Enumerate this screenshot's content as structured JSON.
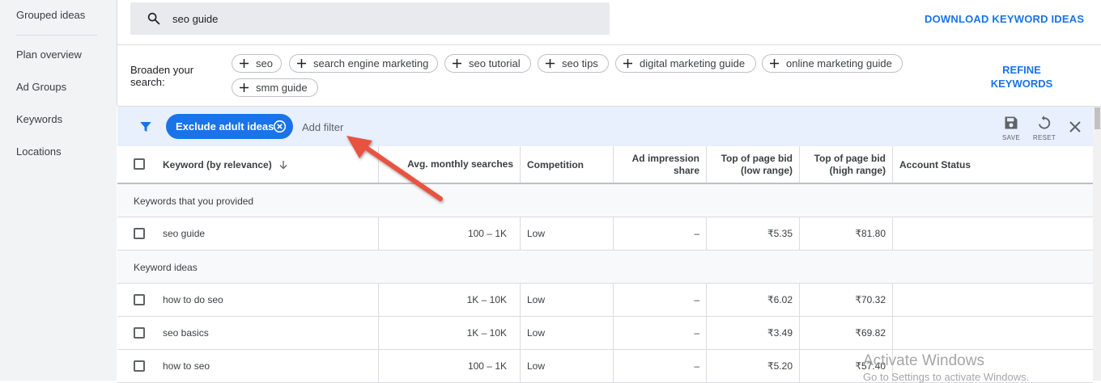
{
  "sidebar": {
    "items": [
      {
        "label": "Grouped ideas"
      },
      {
        "label": "Plan overview"
      },
      {
        "label": "Ad Groups"
      },
      {
        "label": "Keywords"
      },
      {
        "label": "Locations"
      }
    ]
  },
  "search": {
    "value": "seo guide",
    "icon": "search-icon"
  },
  "header": {
    "download_label": "DOWNLOAD KEYWORD IDEAS"
  },
  "broaden": {
    "label": "Broaden your search:",
    "chips": [
      "seo",
      "search engine marketing",
      "seo tutorial",
      "seo tips",
      "digital marketing guide",
      "online marketing guide",
      "smm guide"
    ],
    "refine_line1": "REFINE",
    "refine_line2": "KEYWORDS"
  },
  "filter_bar": {
    "active_filter": "Exclude adult ideas",
    "add_filter": "Add filter",
    "save_label": "SAVE",
    "reset_label": "RESET"
  },
  "table": {
    "columns": [
      "Keyword (by relevance)",
      "Avg. monthly searches",
      "Competition",
      "Ad impression share",
      "Top of page bid (low range)",
      "Top of page bid (high range)",
      "Account Status"
    ],
    "column_lines": {
      "ad_impression_1": "Ad impression",
      "ad_impression_2": "share",
      "low_1": "Top of page bid",
      "low_2": "(low range)",
      "high_1": "Top of page bid",
      "high_2": "(high range)"
    },
    "groups": [
      {
        "label": "Keywords that you provided",
        "rows": [
          {
            "keyword": "seo guide",
            "searches": "100 – 1K",
            "competition": "Low",
            "impression": "–",
            "low": "₹5.35",
            "high": "₹81.80",
            "status": ""
          }
        ]
      },
      {
        "label": "Keyword ideas",
        "rows": [
          {
            "keyword": "how to do seo",
            "searches": "1K – 10K",
            "competition": "Low",
            "impression": "–",
            "low": "₹6.02",
            "high": "₹70.32",
            "status": ""
          },
          {
            "keyword": "seo basics",
            "searches": "1K – 10K",
            "competition": "Low",
            "impression": "–",
            "low": "₹3.49",
            "high": "₹69.82",
            "status": ""
          },
          {
            "keyword": "how to seo",
            "searches": "100 – 1K",
            "competition": "Low",
            "impression": "–",
            "low": "₹5.20",
            "high": "₹57.40",
            "status": ""
          }
        ]
      }
    ]
  },
  "watermark": {
    "line1": "Activate Windows",
    "line2": "Go to Settings to activate Windows."
  },
  "colors": {
    "accent": "#1a73e8",
    "annotation_arrow": "#e8533f"
  }
}
